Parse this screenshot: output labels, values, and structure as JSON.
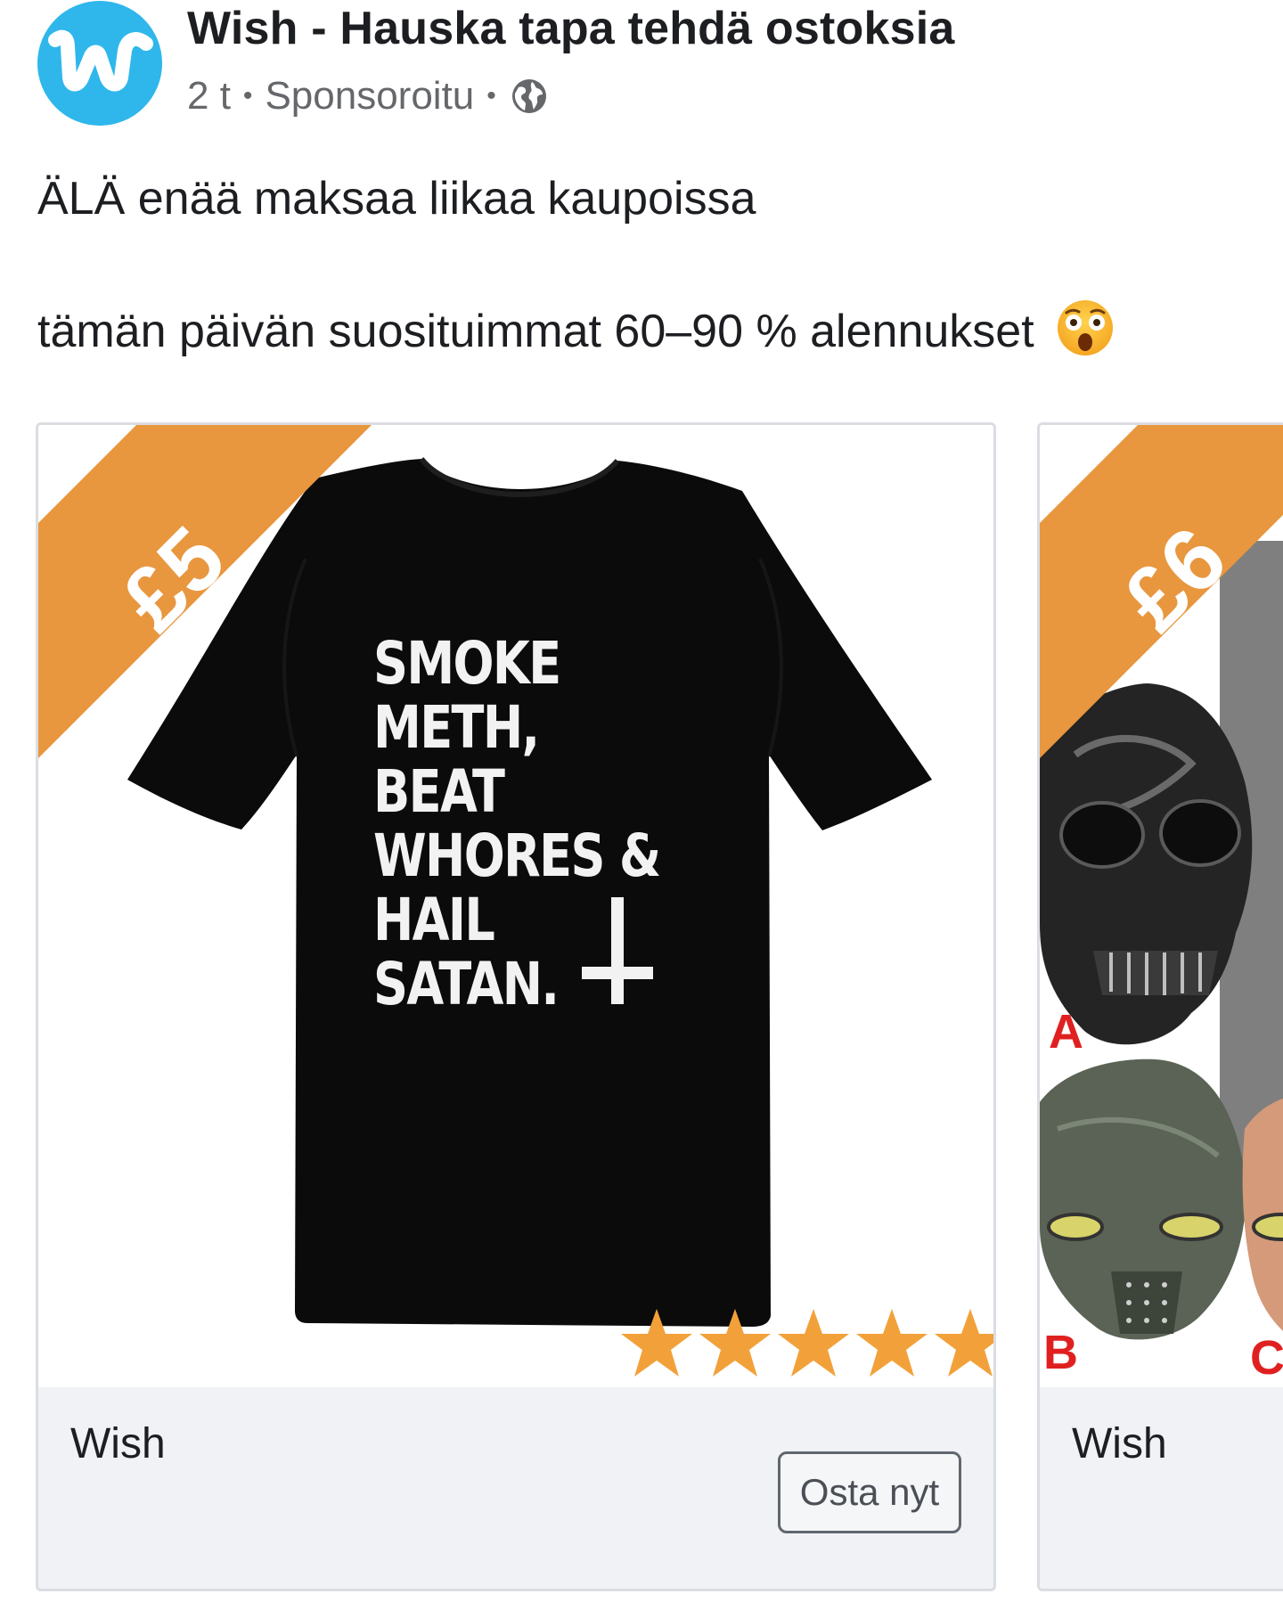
{
  "header": {
    "page_name": "Wish - Hauska tapa tehdä ostoksia",
    "time": "2 t",
    "sponsored": "Sponsoroitu",
    "separator": "•",
    "audience_icon": "globe-icon",
    "avatar_letter": "w",
    "avatar_color": "#2fb7ec"
  },
  "post": {
    "line1": "ÄLÄ enää maksaa liikaa kaupoissa",
    "line2": "tämän päivän suosituimmat 60–90 % alennukset",
    "emoji": "astonished-face-emoji"
  },
  "carousel": {
    "cards": [
      {
        "price": "£5",
        "shirt_text": [
          "SMOKE",
          "METH,",
          "BEAT",
          "WHORES &",
          "HAIL",
          "SATAN."
        ],
        "rating_stars": 5,
        "title": "Wish",
        "cta": "Osta nyt"
      },
      {
        "price": "£6",
        "variant_labels": [
          "A",
          "B",
          "C"
        ],
        "title": "Wish"
      }
    ]
  },
  "colors": {
    "ribbon": "#e8973f",
    "star": "#f2a13a",
    "footer_bg": "#f0f2f5",
    "text_primary": "#1c1e21",
    "text_secondary": "#65676b",
    "variant_label": "#e02020"
  }
}
